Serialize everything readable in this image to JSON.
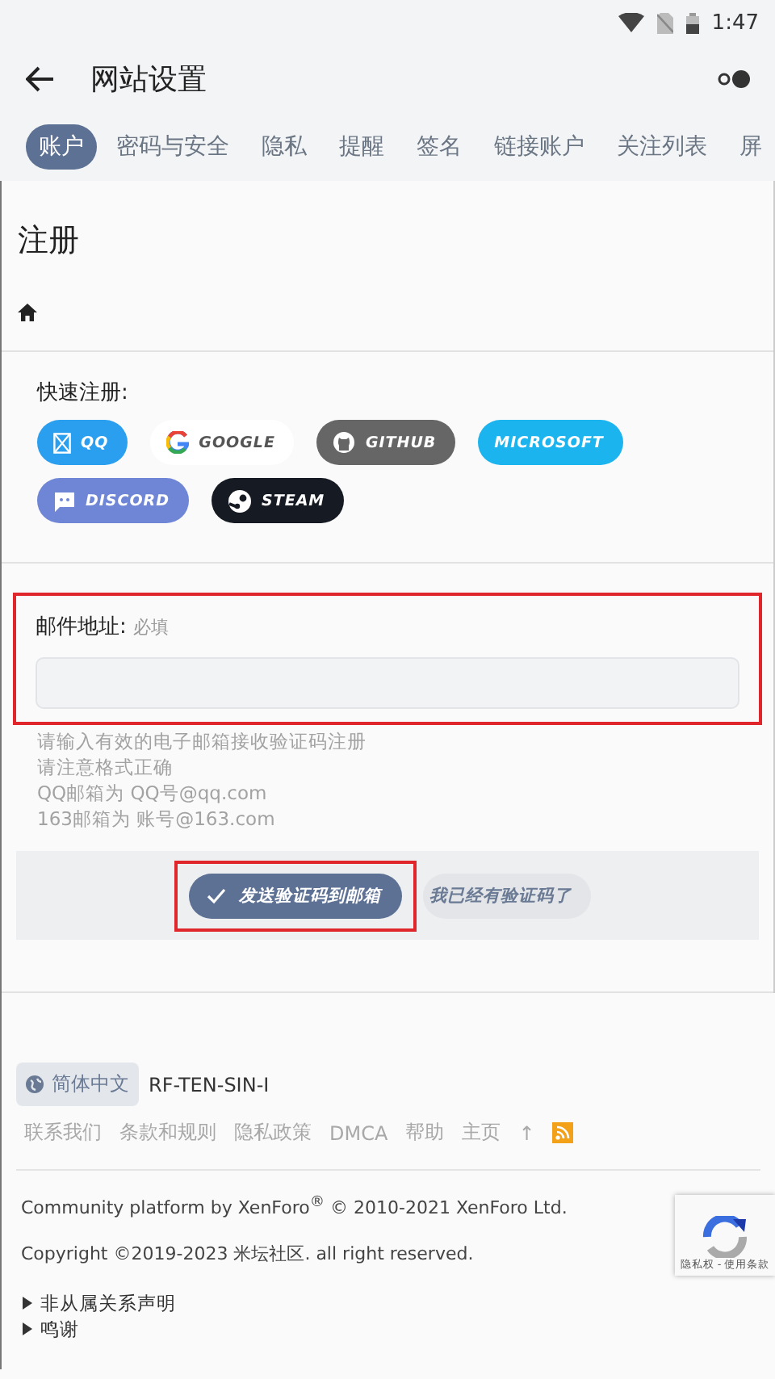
{
  "status_bar": {
    "time": "1:47"
  },
  "app_bar": {
    "title": "网站设置"
  },
  "tabs": [
    {
      "label": "账户",
      "selected": true
    },
    {
      "label": "密码与安全",
      "selected": false
    },
    {
      "label": "隐私",
      "selected": false
    },
    {
      "label": "提醒",
      "selected": false
    },
    {
      "label": "签名",
      "selected": false
    },
    {
      "label": "链接账户",
      "selected": false
    },
    {
      "label": "关注列表",
      "selected": false
    },
    {
      "label": "屏",
      "selected": false
    }
  ],
  "page": {
    "title": "注册"
  },
  "quick_register": {
    "label": "快速注册:",
    "providers": [
      {
        "kind": "qq",
        "label": "QQ",
        "color": "#2a9ff0"
      },
      {
        "kind": "google",
        "label": "GOOGLE",
        "color": "#ffffff"
      },
      {
        "kind": "github",
        "label": "GITHUB",
        "color": "#666666"
      },
      {
        "kind": "microsoft",
        "label": "MICROSOFT",
        "color": "#1bb4ee"
      },
      {
        "kind": "discord",
        "label": "DISCORD",
        "color": "#6f86d6"
      },
      {
        "kind": "steam",
        "label": "STEAM",
        "color": "#161a22"
      }
    ]
  },
  "email_field": {
    "label": "邮件地址:",
    "hint": "必填",
    "highlighted": true,
    "explain": [
      "请输入有效的电子邮箱接收验证码注册",
      "请注意格式正确",
      "QQ邮箱为 QQ号@qq.com",
      "163邮箱为 账号@163.com"
    ]
  },
  "actions": {
    "primary": {
      "label": "发送验证码到邮箱",
      "highlighted": true
    },
    "secondary": {
      "label": "我已经有验证码了"
    }
  },
  "footer": {
    "language": "简体中文",
    "style": "RF-TEN-SIN-I",
    "links": [
      {
        "kind": "text",
        "label": "联系我们"
      },
      {
        "kind": "text",
        "label": "条款和规则"
      },
      {
        "kind": "text",
        "label": "隐私政策"
      },
      {
        "kind": "text",
        "label": "DMCA"
      },
      {
        "kind": "text",
        "label": "帮助"
      },
      {
        "kind": "text",
        "label": "主页"
      },
      {
        "kind": "text",
        "label": "↑"
      },
      {
        "kind": "rss"
      }
    ],
    "credits": [
      "Community platform by XenForo$^{®}$ © 2010-2021 XenForo Ltd.",
      "Copyright ©2019-2023 米坛社区. all right reserved."
    ],
    "disclosures": [
      {
        "label": "非从属关系声明",
        "expanded": false
      },
      {
        "label": "鸣谢",
        "expanded": false
      }
    ]
  },
  "recaptcha": {
    "links": "隐私权 - 使用条款"
  }
}
